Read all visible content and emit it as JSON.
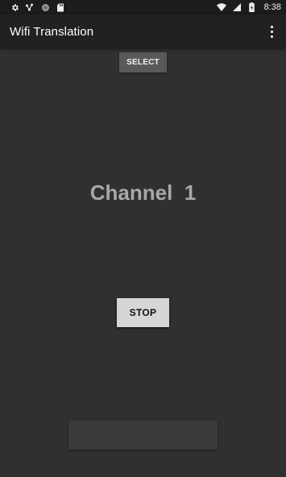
{
  "status_bar": {
    "time": "8:38",
    "icons_left": [
      "gear-icon",
      "network-dots-icon",
      "circle-icon",
      "sd-card-icon"
    ],
    "icons_right": [
      "wifi-icon",
      "signal-icon",
      "battery-icon"
    ]
  },
  "app_bar": {
    "title": "Wifi Translation",
    "overflow_icon": "more-vert-icon"
  },
  "main": {
    "select_label": "SELECT",
    "channel_label": "Channel",
    "channel_value": "1",
    "stop_label": "STOP",
    "bottom_field_value": ""
  },
  "colors": {
    "background": "#303030",
    "app_bar": "#212121",
    "status_bar": "#1c1c1c",
    "select_button": "#595959",
    "stop_button": "#d6d6d6",
    "channel_text": "#a8a8a8"
  }
}
